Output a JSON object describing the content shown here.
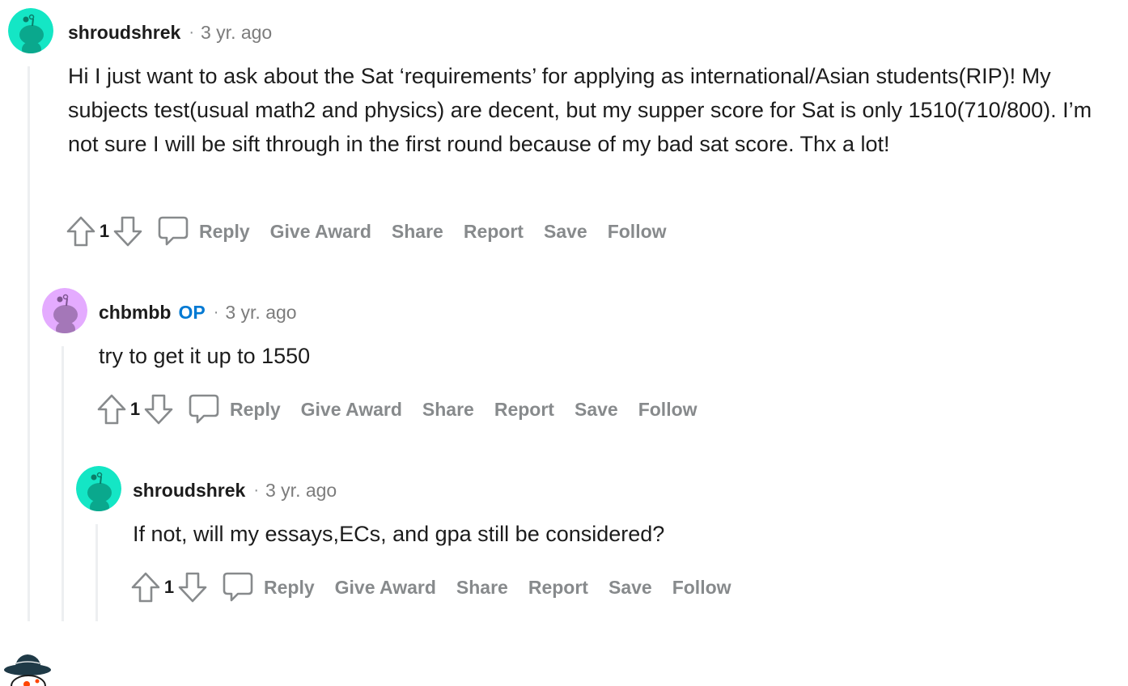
{
  "comments": [
    {
      "author": "shroudshrek",
      "op": "",
      "separator": "·",
      "time": "3 yr. ago",
      "body": "Hi I just want to ask about the Sat ‘requirements’ for applying as international/Asian students(RIP)! My subjects test(usual math2 and physics) are decent, but my supper score for Sat is only 1510(710/800). I’m not sure I will be sift through in the first round because of my bad sat score. Thx a lot!",
      "score": "1",
      "avatar_color": "#14e6c5",
      "actions": {
        "reply": "Reply",
        "award": "Give Award",
        "share": "Share",
        "report": "Report",
        "save": "Save",
        "follow": "Follow"
      }
    },
    {
      "author": "chbmbb",
      "op": "OP",
      "separator": "·",
      "time": "3 yr. ago",
      "body": "try to get it up to 1550",
      "score": "1",
      "avatar_color": "#e4abff",
      "actions": {
        "reply": "Reply",
        "award": "Give Award",
        "share": "Share",
        "report": "Report",
        "save": "Save",
        "follow": "Follow"
      }
    },
    {
      "author": "shroudshrek",
      "op": "",
      "separator": "·",
      "time": "3 yr. ago",
      "body": "If not, will my essays,ECs, and gpa still be considered?",
      "score": "1",
      "avatar_color": "#14e6c5",
      "actions": {
        "reply": "Reply",
        "award": "Give Award",
        "share": "Share",
        "report": "Report",
        "save": "Save",
        "follow": "Follow"
      }
    }
  ],
  "icons": {
    "upvote": "upvote-arrow-icon",
    "downvote": "downvote-arrow-icon",
    "reply": "speech-bubble-icon",
    "avatar": "snoo-avatar-icon"
  }
}
